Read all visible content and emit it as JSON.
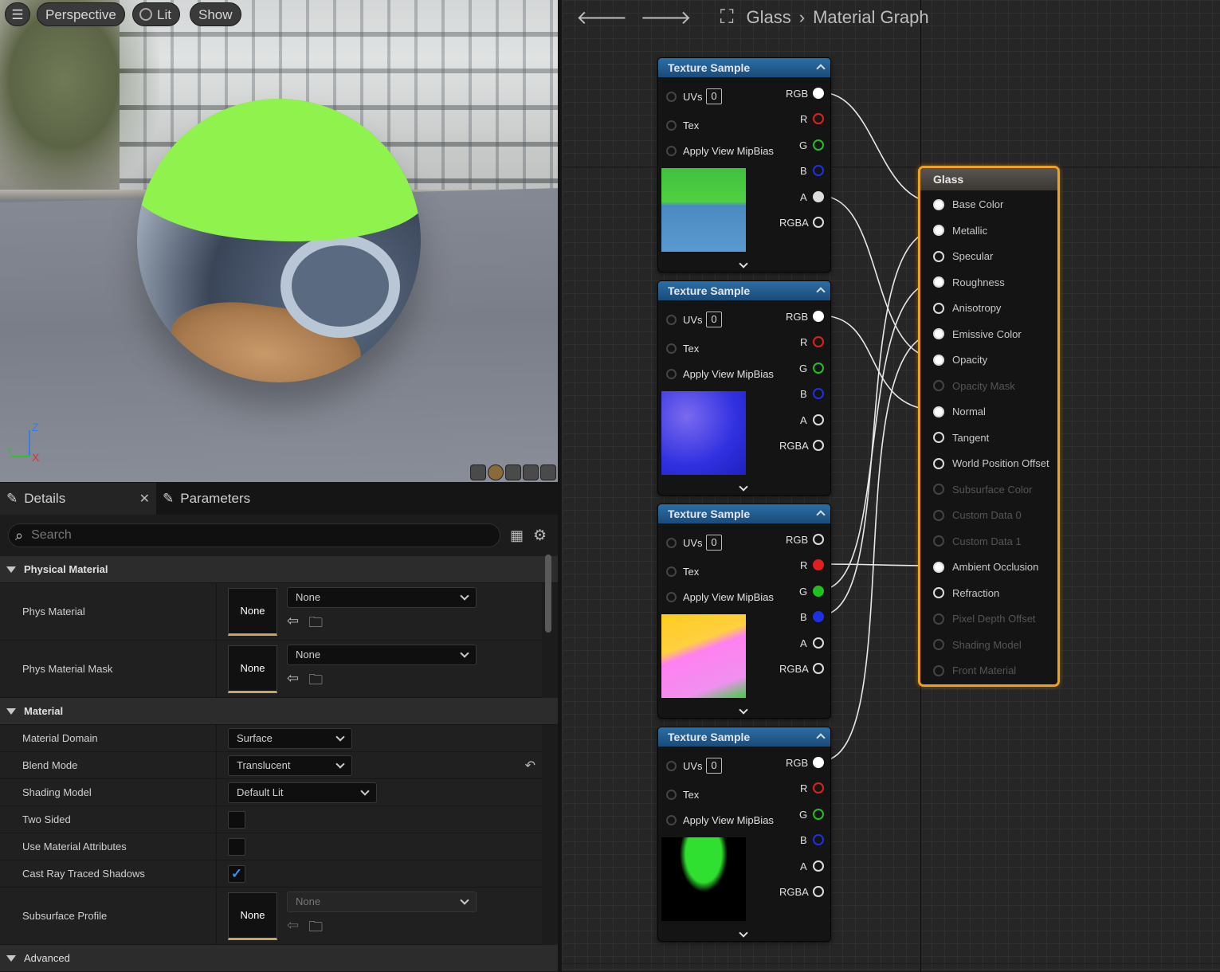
{
  "viewport": {
    "menu_icon": "hamburger-icon",
    "perspective_label": "Perspective",
    "lit_label": "Lit",
    "show_label": "Show",
    "axis_z": "Z",
    "axis_x": "X",
    "axis_y": "Y"
  },
  "details": {
    "tab_details": "Details",
    "tab_parameters": "Parameters",
    "search_placeholder": "Search",
    "sections": {
      "physical_material": "Physical Material",
      "material": "Material",
      "advanced": "Advanced"
    },
    "phys_material": {
      "label": "Phys Material",
      "thumb": "None",
      "value": "None"
    },
    "phys_material_mask": {
      "label": "Phys Material Mask",
      "thumb": "None",
      "value": "None"
    },
    "material_domain": {
      "label": "Material Domain",
      "value": "Surface"
    },
    "blend_mode": {
      "label": "Blend Mode",
      "value": "Translucent"
    },
    "shading_model": {
      "label": "Shading Model",
      "value": "Default Lit"
    },
    "two_sided": {
      "label": "Two Sided",
      "checked": false
    },
    "use_material_attributes": {
      "label": "Use Material Attributes",
      "checked": false
    },
    "cast_ray_traced_shadows": {
      "label": "Cast Ray Traced Shadows",
      "checked": true
    },
    "subsurface_profile": {
      "label": "Subsurface Profile",
      "thumb": "None",
      "value": "None"
    }
  },
  "graph": {
    "breadcrumb_root": "Glass",
    "breadcrumb_current": "Material Graph",
    "texture_nodes": [
      {
        "title": "Texture Sample",
        "uv_value": "0"
      },
      {
        "title": "Texture Sample",
        "uv_value": "0"
      },
      {
        "title": "Texture Sample",
        "uv_value": "0"
      },
      {
        "title": "Texture Sample",
        "uv_value": "0"
      }
    ],
    "node_inputs": [
      "UVs",
      "Tex",
      "Apply View MipBias"
    ],
    "node_outputs": [
      "RGB",
      "R",
      "G",
      "B",
      "A",
      "RGBA"
    ],
    "glass_node": {
      "title": "Glass",
      "pins": [
        {
          "label": "Base Color",
          "state": "on"
        },
        {
          "label": "Metallic",
          "state": "on"
        },
        {
          "label": "Specular",
          "state": "off"
        },
        {
          "label": "Roughness",
          "state": "on"
        },
        {
          "label": "Anisotropy",
          "state": "off"
        },
        {
          "label": "Emissive Color",
          "state": "on"
        },
        {
          "label": "Opacity",
          "state": "on"
        },
        {
          "label": "Opacity Mask",
          "state": "dim"
        },
        {
          "label": "Normal",
          "state": "on"
        },
        {
          "label": "Tangent",
          "state": "off"
        },
        {
          "label": "World Position Offset",
          "state": "off"
        },
        {
          "label": "Subsurface Color",
          "state": "dim"
        },
        {
          "label": "Custom Data 0",
          "state": "dim"
        },
        {
          "label": "Custom Data 1",
          "state": "dim"
        },
        {
          "label": "Ambient Occlusion",
          "state": "on"
        },
        {
          "label": "Refraction",
          "state": "off"
        },
        {
          "label": "Pixel Depth Offset",
          "state": "dim"
        },
        {
          "label": "Shading Model",
          "state": "dim"
        },
        {
          "label": "Front Material",
          "state": "dim"
        }
      ]
    },
    "colors": {
      "accent": "#f0a020",
      "node_header": "#2b6ea7",
      "pin_r": "#e02020",
      "pin_g": "#20c020",
      "pin_b": "#2030e0"
    }
  }
}
